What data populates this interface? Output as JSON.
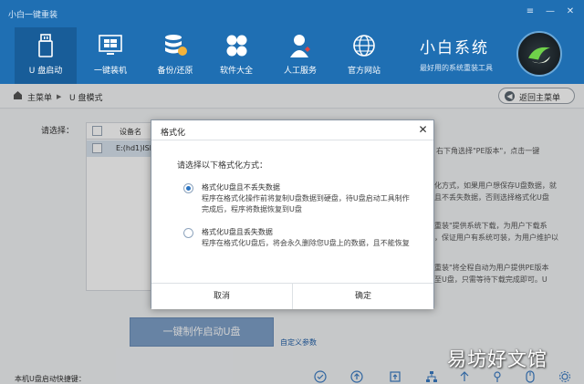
{
  "window": {
    "title": "小白一键重装",
    "controls": {
      "menu": "≡",
      "minimize": "—",
      "close": "✕"
    }
  },
  "nav": {
    "items": [
      {
        "label": "U 盘启动",
        "icon": "usb-drive-icon",
        "active": true
      },
      {
        "label": "一键装机",
        "icon": "monitor-windows-icon",
        "active": false
      },
      {
        "label": "备份/还原",
        "icon": "database-backup-icon",
        "active": false
      },
      {
        "label": "软件大全",
        "icon": "apps-grid-icon",
        "active": false
      },
      {
        "label": "人工服务",
        "icon": "support-agent-icon",
        "active": false
      },
      {
        "label": "官方网站",
        "icon": "globe-icon",
        "active": false
      }
    ]
  },
  "brand": {
    "name": "小白系统",
    "slogan": "最好用的系统重装工具",
    "logo_icon": "xiaobai-logo-icon"
  },
  "breadcrumb": {
    "home": "主菜单",
    "separator": "▶",
    "current": "U 盘模式",
    "back_label": "返回主菜单"
  },
  "main": {
    "select_label": "请选择：",
    "table": {
      "header": "设备名",
      "rows": [
        {
          "device": "E:(hd1)ISI"
        }
      ]
    },
    "side_texts": [
      "，右下角选择\"PE版本\"，点击一键",
      "化方式，如果用户想保存U盘数据，就",
      "且不丢失数据，否则选择格式化U盘",
      "重装\"提供系统下载，为用户下载系",
      "，保证用户有系统可装，为用户维护以",
      "重装\"将全程自动为用户提供PE版本",
      "至U盘，只需等待下载完成即可。U"
    ],
    "make_button": "一键制作启动U盘",
    "custom_link": "自定义参数",
    "bottom_label": "本机U盘启动快捷键：",
    "tool_icons": [
      "check-circle-icon",
      "upload-icon",
      "upload-box-icon",
      "network-icon",
      "arrow-up-icon",
      "pin-icon",
      "mouse-icon",
      "gear-icon"
    ]
  },
  "dialog": {
    "title": "格式化",
    "close": "✕",
    "prompt": "请选择以下格式化方式：",
    "options": [
      {
        "title": "格式化U盘且不丢失数据",
        "desc_line1": "程序在格式化操作前将复制U盘数据到硬盘，待U盘启动工具制作",
        "desc_line2": "完成后，程序将数据恢复到U盘",
        "selected": true
      },
      {
        "title": "格式化U盘且丢失数据",
        "desc_line1": "程序在格式化U盘后，将会永久删除您U盘上的数据，且不能恢复",
        "selected": false
      }
    ],
    "cancel": "取消",
    "ok": "确定"
  },
  "watermark": "易坊好文馆",
  "colors": {
    "header": "#1f6fb3",
    "active_nav": "#185d99",
    "accent": "#2a74c2"
  }
}
